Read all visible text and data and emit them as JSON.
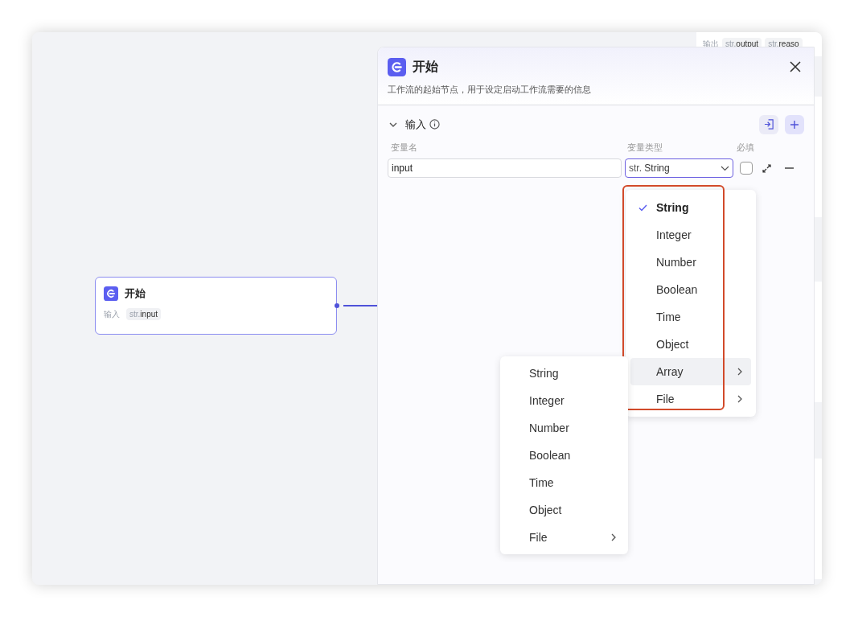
{
  "background_node": {
    "label": "输出",
    "params": [
      {
        "type": "str.",
        "name": "output"
      },
      {
        "type": "str.",
        "name": "reaso"
      }
    ]
  },
  "canvas_node": {
    "title": "开始",
    "label": "输入",
    "param": {
      "type": "str.",
      "name": "input"
    }
  },
  "panel": {
    "title": "开始",
    "description": "工作流的起始节点，用于设定启动工作流需要的信息",
    "section": {
      "title": "输入",
      "expanded": true
    },
    "columns": [
      "变量名",
      "变量类型",
      "必填"
    ],
    "rows": [
      {
        "name": "input",
        "type_prefix": "str.",
        "type": "String",
        "required": false
      }
    ]
  },
  "type_menu": {
    "items": [
      {
        "label": "String",
        "selected": true,
        "hovered": false,
        "submenu": false
      },
      {
        "label": "Integer",
        "selected": false,
        "hovered": false,
        "submenu": false
      },
      {
        "label": "Number",
        "selected": false,
        "hovered": false,
        "submenu": false
      },
      {
        "label": "Boolean",
        "selected": false,
        "hovered": false,
        "submenu": false
      },
      {
        "label": "Time",
        "selected": false,
        "hovered": false,
        "submenu": false
      },
      {
        "label": "Object",
        "selected": false,
        "hovered": false,
        "submenu": false
      },
      {
        "label": "Array",
        "selected": false,
        "hovered": true,
        "submenu": true
      },
      {
        "label": "File",
        "selected": false,
        "hovered": false,
        "submenu": true
      }
    ]
  },
  "array_submenu": {
    "items": [
      {
        "label": "String",
        "submenu": false
      },
      {
        "label": "Integer",
        "submenu": false
      },
      {
        "label": "Number",
        "submenu": false
      },
      {
        "label": "Boolean",
        "submenu": false
      },
      {
        "label": "Time",
        "submenu": false
      },
      {
        "label": "Object",
        "submenu": false
      },
      {
        "label": "File",
        "submenu": true
      }
    ]
  }
}
